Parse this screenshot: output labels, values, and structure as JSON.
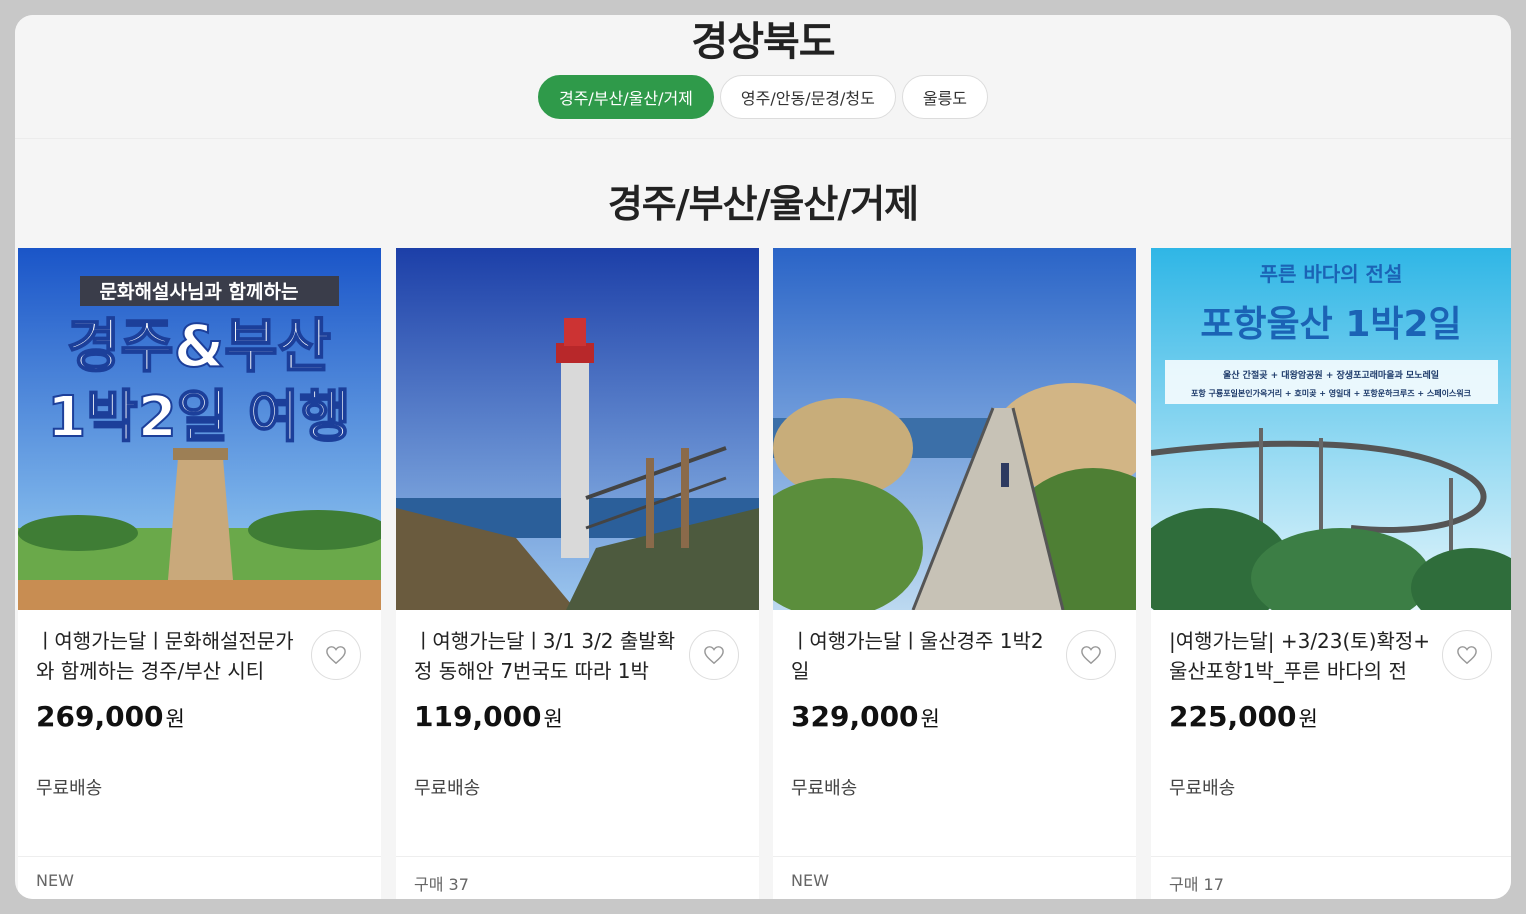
{
  "header": {
    "region_title": "경상북도",
    "tabs": [
      {
        "label": "경주/부산/울산/거제",
        "active": true
      },
      {
        "label": "영주/안동/문경/청도",
        "active": false
      },
      {
        "label": "울릉도",
        "active": false
      }
    ]
  },
  "section": {
    "title": "경주/부산/울산/거제"
  },
  "products": [
    {
      "name": "ㅣ여행가는달ㅣ문화해설전문가와 함께하는 경주/부산 시티",
      "price": "269,000",
      "currency": "원",
      "shipping": "무료배송",
      "footer": "NEW",
      "image": {
        "banner": "문화해설사님과 함께하는",
        "headline_1": "경주&부산",
        "headline_2": "1박2일 여행"
      }
    },
    {
      "name": "ㅣ여행가는달ㅣ3/1 3/2 출발확정 동해안 7번국도 따라 1박",
      "price": "119,000",
      "currency": "원",
      "shipping": "무료배송",
      "footer": "구매 37",
      "image": {}
    },
    {
      "name": "ㅣ여행가는달ㅣ울산경주 1박2일",
      "price": "329,000",
      "currency": "원",
      "shipping": "무료배송",
      "footer": "NEW",
      "image": {}
    },
    {
      "name": "|여행가는달| +3/23(토)확정+ 울산포항1박_푸른 바다의 전",
      "price": "225,000",
      "currency": "원",
      "shipping": "무료배송",
      "footer": "구매 17",
      "image": {
        "subtitle": "푸른 바다의 전설",
        "headline": "포항울산 1박2일",
        "line_1": "울산 간절곶 + 대왕암공원 + 장생포고래마을과 모노레일",
        "line_2": "포항 구룡포일본인가옥거리 + 호미곶 + 영일대 + 포항운하크루즈 + 스페이스워크"
      }
    }
  ],
  "icons": {
    "wishlist": "heart-outline-icon"
  },
  "colors": {
    "accent": "#2f9a4a"
  }
}
